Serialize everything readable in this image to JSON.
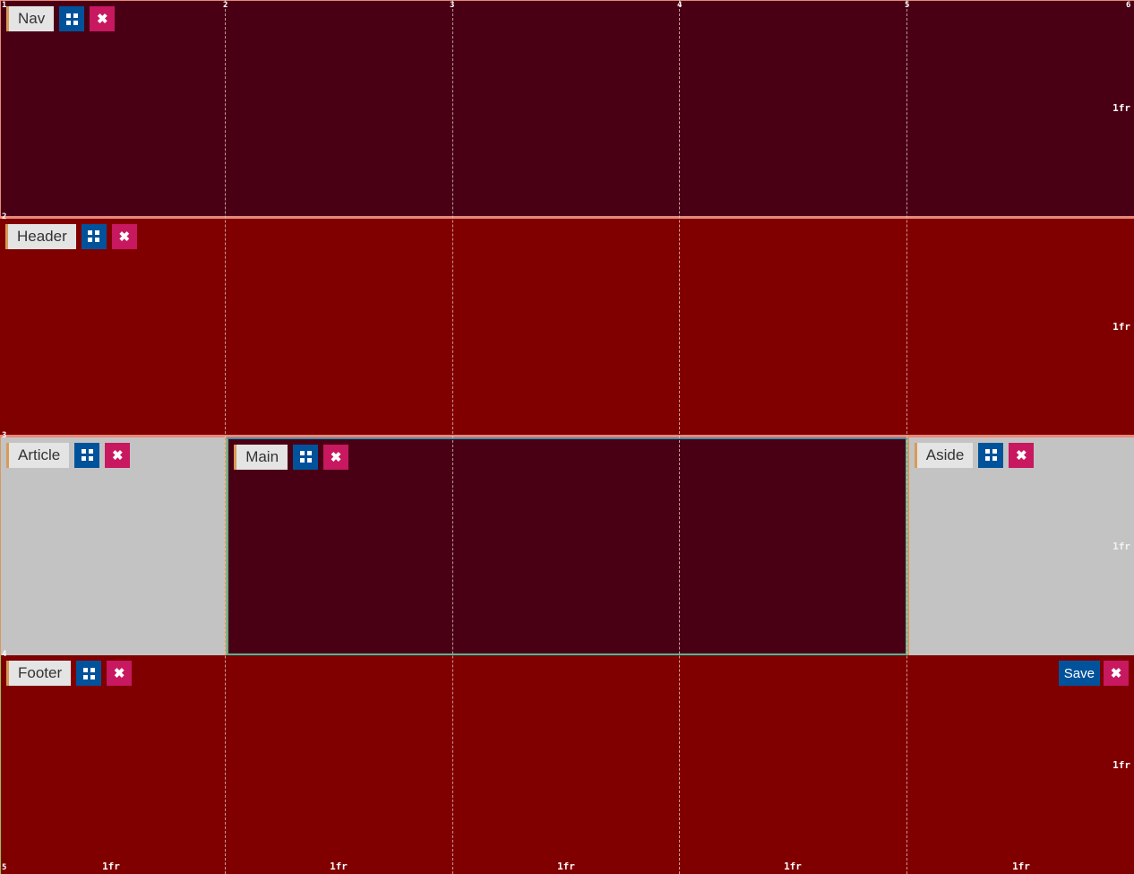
{
  "areas": {
    "nav": {
      "label": "Nav"
    },
    "header": {
      "label": "Header"
    },
    "article": {
      "label": "Article"
    },
    "main": {
      "label": "Main"
    },
    "aside": {
      "label": "Aside"
    },
    "footer": {
      "label": "Footer"
    }
  },
  "controls": {
    "close_glyph": "✖",
    "save_label": "Save"
  },
  "overlay": {
    "column_lines": [
      "1",
      "2",
      "3",
      "4",
      "5",
      "6"
    ],
    "row_lines": [
      "1",
      "2",
      "3",
      "4",
      "5"
    ],
    "row_sizes": [
      "1fr",
      "1fr",
      "1fr",
      "1fr"
    ],
    "column_sizes": [
      "1fr",
      "1fr",
      "1fr",
      "1fr",
      "1fr"
    ]
  },
  "colors": {
    "dark_area": "#4a0014",
    "red_area": "#800000",
    "grey_area": "#c3c3c3",
    "grid_button": "#00529b",
    "close_button": "#c71860"
  }
}
